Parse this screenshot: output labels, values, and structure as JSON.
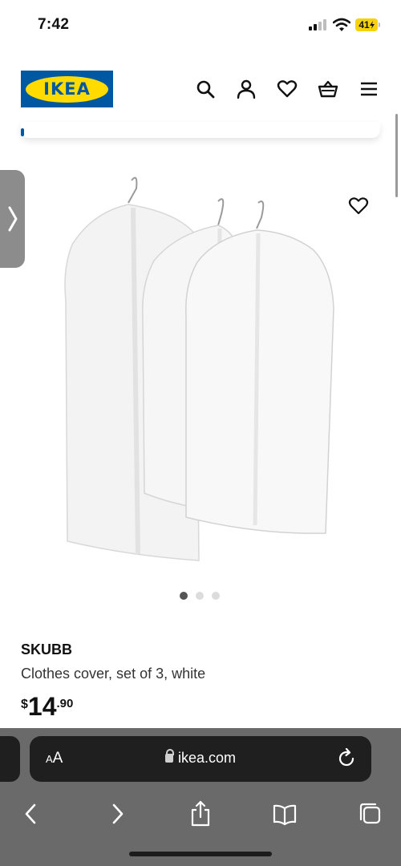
{
  "status_bar": {
    "time": "7:42",
    "battery": "41"
  },
  "header": {
    "logo_text": "IKEA"
  },
  "product": {
    "name": "SKUBB",
    "description": "Clothes cover, set of 3, white",
    "price": {
      "currency": "$",
      "integer": "14",
      "decimal": ".90"
    },
    "image_count": 3,
    "active_image": 1
  },
  "browser": {
    "text_size_label": "AA",
    "url": "ikea.com"
  },
  "icons": {
    "header": [
      "search-icon",
      "account-icon",
      "heart-icon",
      "basket-icon",
      "menu-icon"
    ],
    "toolbar": [
      "back-icon",
      "forward-icon",
      "share-icon",
      "bookmarks-icon",
      "tabs-icon"
    ]
  },
  "colors": {
    "ikea_blue": "#0058a3",
    "ikea_yellow": "#ffdb00",
    "battery": "#f5d20c",
    "safari_chrome": "#6a6a6a"
  }
}
